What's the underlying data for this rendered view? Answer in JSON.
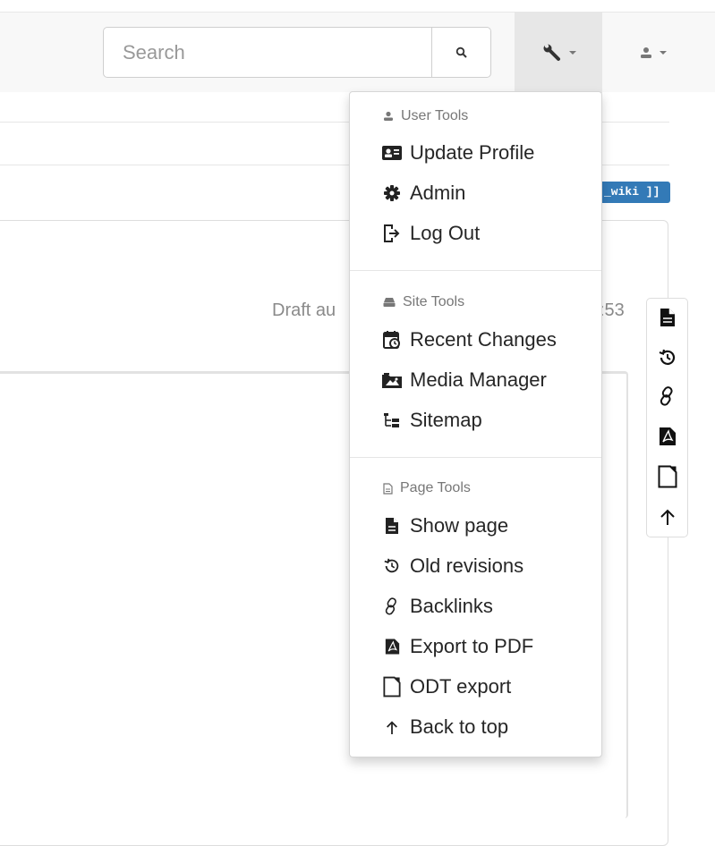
{
  "navbar": {
    "search": {
      "placeholder": "Search"
    },
    "tools_menu_icon": "wrench-icon",
    "user_menu_icon": "user-icon"
  },
  "page": {
    "wiki_badge": "_wiki ]]",
    "draft_prefix": "Draft au",
    "draft_suffix": ":53"
  },
  "dropdown": {
    "sections": [
      {
        "header": "User Tools",
        "icon": "user-icon",
        "items": [
          {
            "label": "Update Profile",
            "icon": "id-card-icon"
          },
          {
            "label": "Admin",
            "icon": "gear-icon"
          },
          {
            "label": "Log Out",
            "icon": "logout-icon"
          }
        ]
      },
      {
        "header": "Site Tools",
        "icon": "hdd-icon",
        "items": [
          {
            "label": "Recent Changes",
            "icon": "calendar-clock-icon"
          },
          {
            "label": "Media Manager",
            "icon": "folder-image-icon"
          },
          {
            "label": "Sitemap",
            "icon": "sitemap-icon"
          }
        ]
      },
      {
        "header": "Page Tools",
        "icon": "file-outline-icon",
        "items": [
          {
            "label": "Show page",
            "icon": "file-icon"
          },
          {
            "label": "Old revisions",
            "icon": "history-icon"
          },
          {
            "label": "Backlinks",
            "icon": "link-icon"
          },
          {
            "label": "Export to PDF",
            "icon": "pdf-icon"
          },
          {
            "label": "ODT export",
            "icon": "odt-file-icon"
          },
          {
            "label": "Back to top",
            "icon": "arrow-up-icon"
          }
        ]
      }
    ]
  },
  "colors": {
    "navbar_bg": "#f8f8f8",
    "active_toggle_bg": "#e7e7e7",
    "badge_bg": "#337ab7",
    "text": "#262626",
    "muted": "#777777"
  }
}
